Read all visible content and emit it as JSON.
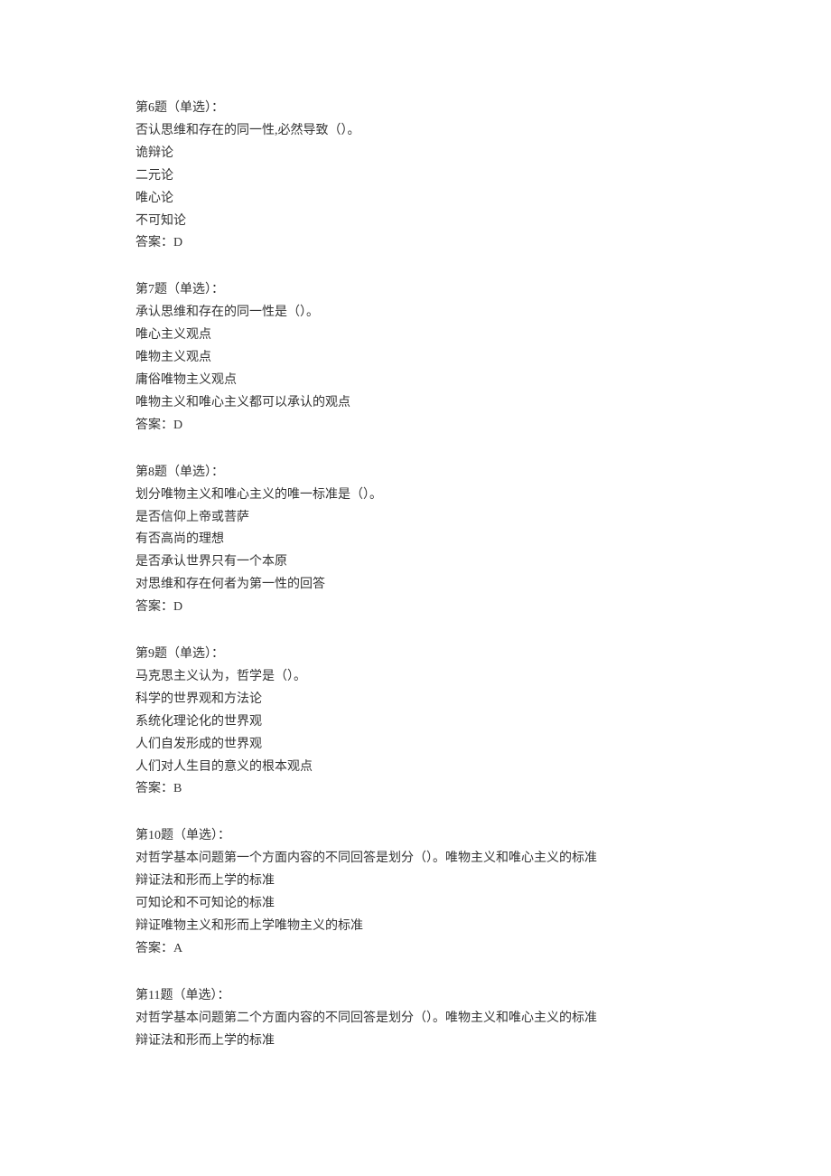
{
  "questions": [
    {
      "header": "第6题（单选）：",
      "prompt": "否认思维和存在的同一性,必然导致（）。",
      "options": [
        "诡辩论",
        "二元论",
        "唯心论",
        "不可知论"
      ],
      "answer": "答案：D"
    },
    {
      "header": "第7题（单选）：",
      "prompt": "承认思维和存在的同一性是（）。",
      "options": [
        "唯心主义观点",
        "唯物主义观点",
        "庸俗唯物主义观点",
        "唯物主义和唯心主义都可以承认的观点"
      ],
      "answer": "答案：D"
    },
    {
      "header": "第8题（单选）：",
      "prompt": "划分唯物主义和唯心主义的唯一标准是（）。",
      "options": [
        "是否信仰上帝或菩萨",
        "有否高尚的理想",
        "是否承认世界只有一个本原",
        "对思维和存在何者为第一性的回答"
      ],
      "answer": "答案：D"
    },
    {
      "header": "第9题（单选）：",
      "prompt": "马克思主义认为，哲学是（）。",
      "options": [
        "科学的世界观和方法论",
        "系统化理论化的世界观",
        "人们自发形成的世界观",
        "人们对人生目的意义的根本观点"
      ],
      "answer": "答案：B"
    },
    {
      "header": "第10题（单选）：",
      "prompt": "对哲学基本问题第一个方面内容的不同回答是划分（）。唯物主义和唯心主义的标准",
      "options": [
        "辩证法和形而上学的标准",
        "可知论和不可知论的标准",
        "辩证唯物主义和形而上学唯物主义的标准"
      ],
      "answer": "答案：A"
    },
    {
      "header": "第11题（单选）：",
      "prompt": "对哲学基本问题第二个方面内容的不同回答是划分（）。唯物主义和唯心主义的标准",
      "options": [
        "辩证法和形而上学的标准"
      ],
      "answer": null
    }
  ]
}
